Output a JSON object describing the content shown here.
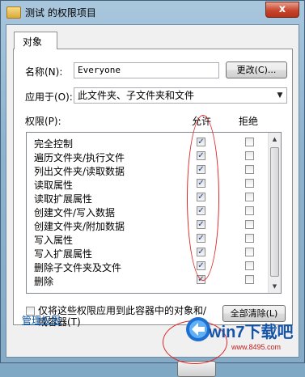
{
  "window": {
    "title": "测试 的权限项目",
    "close_label": "x"
  },
  "tab": {
    "label": "对象"
  },
  "name_row": {
    "label": "名称(N):",
    "value": "Everyone",
    "change_button": "更改(C)..."
  },
  "apply_to": {
    "label": "应用于(O):",
    "value": "此文件夹、子文件夹和文件"
  },
  "permissions": {
    "label": "权限(P):",
    "allow_header": "允许",
    "deny_header": "拒绝",
    "items": [
      {
        "name": "完全控制",
        "allow": true,
        "deny": false
      },
      {
        "name": "遍历文件夹/执行文件",
        "allow": true,
        "deny": false
      },
      {
        "name": "列出文件夹/读取数据",
        "allow": true,
        "deny": false
      },
      {
        "name": "读取属性",
        "allow": true,
        "deny": false
      },
      {
        "name": "读取扩展属性",
        "allow": true,
        "deny": false
      },
      {
        "name": "创建文件/写入数据",
        "allow": true,
        "deny": false
      },
      {
        "name": "创建文件夹/附加数据",
        "allow": true,
        "deny": false
      },
      {
        "name": "写入属性",
        "allow": true,
        "deny": false
      },
      {
        "name": "写入扩展属性",
        "allow": true,
        "deny": false
      },
      {
        "name": "删除子文件夹及文件",
        "allow": true,
        "deny": false
      },
      {
        "name": "删除",
        "allow": true,
        "deny": false
      }
    ]
  },
  "apply_only": {
    "label": "仅将这些权限应用到此容器中的对象和/或容器(T)"
  },
  "clear_all_button": "全部清除(L)",
  "manage_link": "管理权限",
  "watermark": {
    "brand": "win7下载吧",
    "url": "www.8495.com"
  },
  "colors": {
    "highlight": "#e02828",
    "link": "#0b4f9a",
    "title_bar": "#a9c7dd"
  }
}
